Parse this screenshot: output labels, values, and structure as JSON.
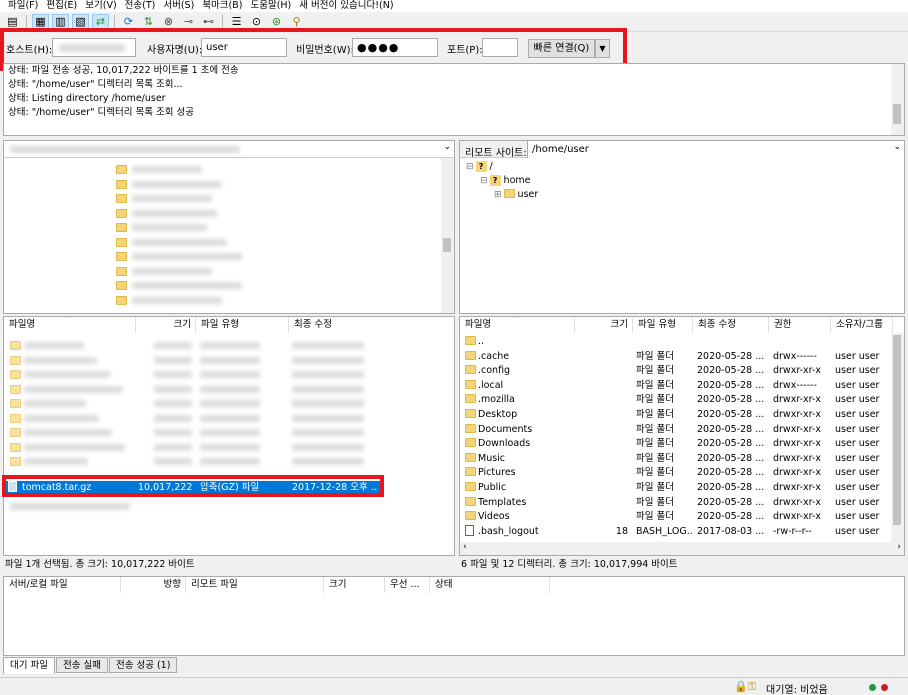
{
  "menu": [
    "파일(F)",
    "편집(E)",
    "보기(V)",
    "전송(T)",
    "서버(S)",
    "북마크(B)",
    "도움말(H)",
    "새 버전이 있습니다!(N)"
  ],
  "quickconnect": {
    "host_label": "호스트(H):",
    "host_value": "",
    "user_label": "사용자명(U):",
    "user_value": "user",
    "pass_label": "비밀번호(W):",
    "pass_value": "●●●●",
    "port_label": "포트(P):",
    "port_value": "",
    "connect_button": "빠른 연결(Q)",
    "dropdown_arrow": "▼"
  },
  "log": [
    "상태: 파일 전송 성공, 10,017,222 바이트를 1 초에 전송",
    "상태: \"/home/user\" 디렉터리 목록 조회...",
    "상태: Listing directory /home/user",
    "상태: \"/home/user\" 디렉터리 목록 조회 성공"
  ],
  "remote_site": {
    "label": "리모트 사이트:",
    "path": "/home/user",
    "tree": [
      {
        "name": "/",
        "expander": "⊟"
      },
      {
        "name": "home",
        "expander": "⊟"
      },
      {
        "name": "user",
        "expander": "⊞"
      }
    ]
  },
  "local_list": {
    "columns": [
      "파일명",
      "크기",
      "파일 유형",
      "최종 수정"
    ],
    "selected_file": {
      "name": "tomcat8.tar.gz",
      "size": "10,017,222",
      "type": "압축(GZ) 파일",
      "modified": "2017-12-28 오후 ..."
    },
    "status": "파일 1개 선택됨. 총 크기: 10,017,222 바이트"
  },
  "remote_list": {
    "columns": [
      "파일명",
      "크기",
      "파일 유형",
      "최종 수정",
      "권한",
      "소유자/그룹"
    ],
    "rows": [
      {
        "name": "..",
        "size": "",
        "type": "",
        "modified": "",
        "perm": "",
        "owner": "",
        "kind": "folder"
      },
      {
        "name": ".cache",
        "size": "",
        "type": "파일 폴더",
        "modified": "2020-05-28 ...",
        "perm": "drwx------",
        "owner": "user user",
        "kind": "folder"
      },
      {
        "name": ".config",
        "size": "",
        "type": "파일 폴더",
        "modified": "2020-05-28 ...",
        "perm": "drwxr-xr-x",
        "owner": "user user",
        "kind": "folder"
      },
      {
        "name": ".local",
        "size": "",
        "type": "파일 폴더",
        "modified": "2020-05-28 ...",
        "perm": "drwx------",
        "owner": "user user",
        "kind": "folder"
      },
      {
        "name": ".mozilla",
        "size": "",
        "type": "파일 폴더",
        "modified": "2020-05-28 ...",
        "perm": "drwxr-xr-x",
        "owner": "user user",
        "kind": "folder"
      },
      {
        "name": "Desktop",
        "size": "",
        "type": "파일 폴더",
        "modified": "2020-05-28 ...",
        "perm": "drwxr-xr-x",
        "owner": "user user",
        "kind": "folder"
      },
      {
        "name": "Documents",
        "size": "",
        "type": "파일 폴더",
        "modified": "2020-05-28 ...",
        "perm": "drwxr-xr-x",
        "owner": "user user",
        "kind": "folder"
      },
      {
        "name": "Downloads",
        "size": "",
        "type": "파일 폴더",
        "modified": "2020-05-28 ...",
        "perm": "drwxr-xr-x",
        "owner": "user user",
        "kind": "folder"
      },
      {
        "name": "Music",
        "size": "",
        "type": "파일 폴더",
        "modified": "2020-05-28 ...",
        "perm": "drwxr-xr-x",
        "owner": "user user",
        "kind": "folder"
      },
      {
        "name": "Pictures",
        "size": "",
        "type": "파일 폴더",
        "modified": "2020-05-28 ...",
        "perm": "drwxr-xr-x",
        "owner": "user user",
        "kind": "folder"
      },
      {
        "name": "Public",
        "size": "",
        "type": "파일 폴더",
        "modified": "2020-05-28 ...",
        "perm": "drwxr-xr-x",
        "owner": "user user",
        "kind": "folder"
      },
      {
        "name": "Templates",
        "size": "",
        "type": "파일 폴더",
        "modified": "2020-05-28 ...",
        "perm": "drwxr-xr-x",
        "owner": "user user",
        "kind": "folder"
      },
      {
        "name": "Videos",
        "size": "",
        "type": "파일 폴더",
        "modified": "2020-05-28 ...",
        "perm": "drwxr-xr-x",
        "owner": "user user",
        "kind": "folder"
      },
      {
        "name": ".bash_logout",
        "size": "18",
        "type": "BASH_LOG...",
        "modified": "2017-08-03 ...",
        "perm": "-rw-r--r--",
        "owner": "user user",
        "kind": "file"
      }
    ],
    "status": "6 파일 및 12 디렉터리. 총 크기: 10,017,994 바이트"
  },
  "queue": {
    "columns": [
      "서버/로컬 파일",
      "방향",
      "리모트 파일",
      "크기",
      "우선 ...",
      "상태"
    ],
    "tabs": [
      "대기 파일",
      "전송 실패",
      "전송 성공 (1)"
    ]
  },
  "statusbar": {
    "queue_text": "대기열: 비었음"
  },
  "colors": {
    "selection": "#0078d7",
    "highlight_box": "#e8141e",
    "folder": "#f4d679"
  }
}
